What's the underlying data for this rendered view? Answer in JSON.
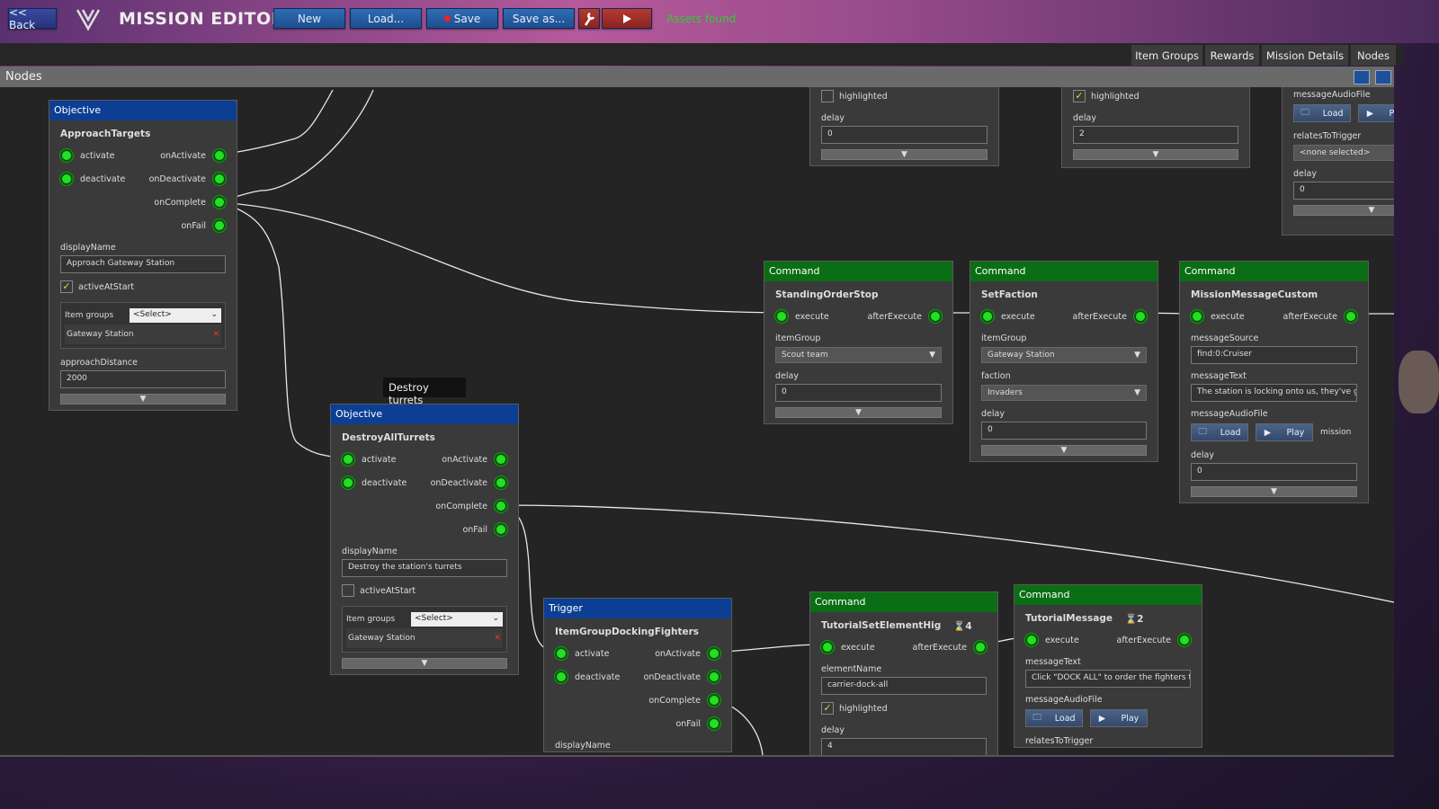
{
  "topbar": {
    "back": "<< Back",
    "title": "MISSION EDITOR",
    "new": "New",
    "load": "Load...",
    "save": "Save",
    "save_as": "Save as...",
    "tools_icon": "wrench-icon",
    "play_icon": "play-icon",
    "status": "Assets found"
  },
  "tabs": [
    "Item Groups",
    "Rewards",
    "Mission Details",
    "Nodes"
  ],
  "panel": {
    "title": "Nodes"
  },
  "tooltip": "Destroy turrets",
  "colors": {
    "objective": "#0c3f94",
    "command": "#0a6e14",
    "port": "#22e022",
    "status": "#33cc33"
  },
  "nodes": [
    {
      "id": "approach",
      "type": "Objective",
      "title": "ApproachTargets",
      "rows": [
        {
          "t": "ports",
          "in": "activate",
          "out": "onActivate"
        },
        {
          "t": "ports",
          "in": "deactivate",
          "out": "onDeactivate"
        },
        {
          "t": "ports",
          "out": "onComplete"
        },
        {
          "t": "ports",
          "out": "onFail"
        },
        {
          "t": "label",
          "text": "displayName"
        },
        {
          "t": "input",
          "value": "Approach Gateway Station"
        },
        {
          "t": "check",
          "checked": true,
          "label": "activeAtStart"
        },
        {
          "t": "itemgroups",
          "label": "Item groups",
          "select": "<Select>",
          "item": "Gateway Station"
        },
        {
          "t": "label",
          "text": "approachDistance"
        },
        {
          "t": "input",
          "value": "2000"
        },
        {
          "t": "expand"
        }
      ]
    },
    {
      "id": "destroy",
      "type": "Objective",
      "title": "DestroyAllTurrets",
      "rows": [
        {
          "t": "ports",
          "in": "activate",
          "out": "onActivate"
        },
        {
          "t": "ports",
          "in": "deactivate",
          "out": "onDeactivate"
        },
        {
          "t": "ports",
          "out": "onComplete"
        },
        {
          "t": "ports",
          "out": "onFail"
        },
        {
          "t": "label",
          "text": "displayName"
        },
        {
          "t": "input",
          "value": "Destroy the station's turrets"
        },
        {
          "t": "check",
          "checked": false,
          "label": "activeAtStart"
        },
        {
          "t": "itemgroups",
          "label": "Item groups",
          "select": "<Select>",
          "item": "Gateway Station"
        },
        {
          "t": "expand"
        }
      ]
    },
    {
      "id": "trigger",
      "type": "Trigger",
      "title": "ItemGroupDockingFighters",
      "rows": [
        {
          "t": "ports",
          "in": "activate",
          "out": "onActivate"
        },
        {
          "t": "ports",
          "in": "deactivate",
          "out": "onDeactivate"
        },
        {
          "t": "ports",
          "out": "onComplete"
        },
        {
          "t": "ports",
          "out": "onFail"
        },
        {
          "t": "label",
          "text": "displayName"
        }
      ]
    },
    {
      "id": "standing",
      "type": "Command",
      "title": "StandingOrderStop",
      "rows": [
        {
          "t": "ports",
          "in": "execute",
          "out": "afterExecute"
        },
        {
          "t": "label",
          "text": "itemGroup"
        },
        {
          "t": "select",
          "value": "Scout team"
        },
        {
          "t": "label",
          "text": "delay"
        },
        {
          "t": "input",
          "value": "0"
        },
        {
          "t": "expand"
        }
      ]
    },
    {
      "id": "faction",
      "type": "Command",
      "title": "SetFaction",
      "rows": [
        {
          "t": "ports",
          "in": "execute",
          "out": "afterExecute"
        },
        {
          "t": "label",
          "text": "itemGroup"
        },
        {
          "t": "select",
          "value": "Gateway Station"
        },
        {
          "t": "label",
          "text": "faction"
        },
        {
          "t": "select",
          "value": "Invaders"
        },
        {
          "t": "label",
          "text": "delay"
        },
        {
          "t": "input",
          "value": "0"
        },
        {
          "t": "expand"
        }
      ]
    },
    {
      "id": "msgcustom",
      "type": "Command",
      "title": "MissionMessageCustom",
      "rows": [
        {
          "t": "ports",
          "in": "execute",
          "out": "afterExecute"
        },
        {
          "t": "label",
          "text": "messageSource"
        },
        {
          "t": "input",
          "value": "find:0:Cruiser"
        },
        {
          "t": "label",
          "text": "messageText"
        },
        {
          "t": "input",
          "value": "The station is locking onto us, they've g"
        },
        {
          "t": "label",
          "text": "messageAudioFile"
        },
        {
          "t": "audio",
          "load": "Load",
          "play": "Play",
          "extra": "mission"
        },
        {
          "t": "label",
          "text": "delay"
        },
        {
          "t": "input",
          "value": "0"
        },
        {
          "t": "expand"
        }
      ]
    },
    {
      "id": "tutset",
      "type": "Command",
      "title": "TutorialSetElementHig",
      "badge": "4",
      "rows": [
        {
          "t": "ports",
          "in": "execute",
          "out": "afterExecute"
        },
        {
          "t": "label",
          "text": "elementName"
        },
        {
          "t": "input",
          "value": "carrier-dock-all"
        },
        {
          "t": "check",
          "checked": true,
          "label": "highlighted"
        },
        {
          "t": "label",
          "text": "delay"
        },
        {
          "t": "input",
          "value": "4"
        }
      ]
    },
    {
      "id": "tutmsg",
      "type": "Command",
      "title": "TutorialMessage",
      "badge": "2",
      "rows": [
        {
          "t": "ports",
          "in": "execute",
          "out": "afterExecute"
        },
        {
          "t": "label",
          "text": "messageText"
        },
        {
          "t": "input",
          "value": "Click \"DOCK ALL\" to order the fighters t"
        },
        {
          "t": "label",
          "text": "messageAudioFile"
        },
        {
          "t": "audio",
          "load": "Load",
          "play": "Play"
        },
        {
          "t": "label",
          "text": "relatesToTrigger"
        }
      ]
    },
    {
      "id": "topA",
      "rows": [
        {
          "t": "check",
          "checked": false,
          "label": "highlighted"
        },
        {
          "t": "label",
          "text": "delay"
        },
        {
          "t": "input",
          "value": "0"
        },
        {
          "t": "expand"
        }
      ]
    },
    {
      "id": "topB",
      "rows": [
        {
          "t": "check",
          "checked": true,
          "label": "highlighted"
        },
        {
          "t": "label",
          "text": "delay"
        },
        {
          "t": "input",
          "value": "2"
        },
        {
          "t": "expand"
        }
      ]
    },
    {
      "id": "topC",
      "rows": [
        {
          "t": "label",
          "text": "messageAudioFile"
        },
        {
          "t": "audio",
          "load": "Load",
          "play": "Play"
        },
        {
          "t": "label",
          "text": "relatesToTrigger"
        },
        {
          "t": "select",
          "value": "<none selected>",
          "noarrow": true
        },
        {
          "t": "label",
          "text": "delay"
        },
        {
          "t": "input",
          "value": "0"
        },
        {
          "t": "expand"
        }
      ]
    }
  ]
}
